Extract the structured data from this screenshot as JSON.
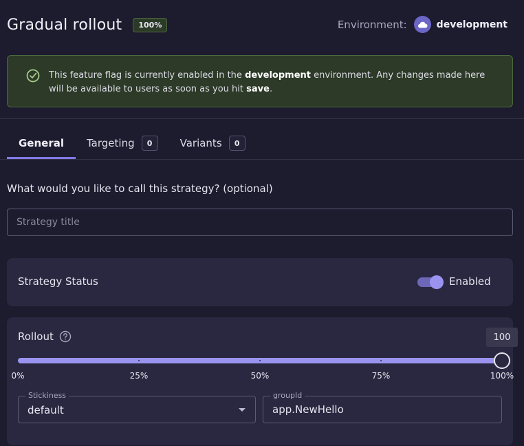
{
  "header": {
    "title": "Gradual rollout",
    "percent_badge": "100%",
    "environment_label": "Environment:",
    "environment_name": "development",
    "environment_icon": "cloud-icon"
  },
  "alert": {
    "icon": "check-circle-icon",
    "text_before": "This feature flag is currently enabled in the ",
    "env_name": "development",
    "text_middle": " environment. Any changes made here will be available to users as soon as you hit ",
    "save_word": "save",
    "text_end": "."
  },
  "tabs": [
    {
      "label": "General",
      "count": null,
      "active": true
    },
    {
      "label": "Targeting",
      "count": "0",
      "active": false
    },
    {
      "label": "Variants",
      "count": "0",
      "active": false
    }
  ],
  "general": {
    "question": "What would you like to call this strategy? (optional)",
    "title_placeholder": "Strategy title",
    "title_value": ""
  },
  "status": {
    "label": "Strategy Status",
    "toggle_label": "Enabled",
    "enabled": true
  },
  "rollout": {
    "label": "Rollout",
    "help_icon": "help-circle-icon",
    "value": 100,
    "tooltip": "100",
    "min": 0,
    "max": 100,
    "marks": [
      {
        "value": 0,
        "label": "0%"
      },
      {
        "value": 25,
        "label": "25%"
      },
      {
        "value": 50,
        "label": "50%"
      },
      {
        "value": 75,
        "label": "75%"
      },
      {
        "value": 100,
        "label": "100%"
      }
    ],
    "stickiness_label": "Stickiness",
    "stickiness_value": "default",
    "groupid_label": "groupId",
    "groupid_value": "app.NewHello"
  },
  "colors": {
    "background": "#1d1b2e",
    "card": "#2a2840",
    "accent": "#817ae6",
    "success_bg": "#2c3a27",
    "success_border": "#4c6a3e"
  }
}
